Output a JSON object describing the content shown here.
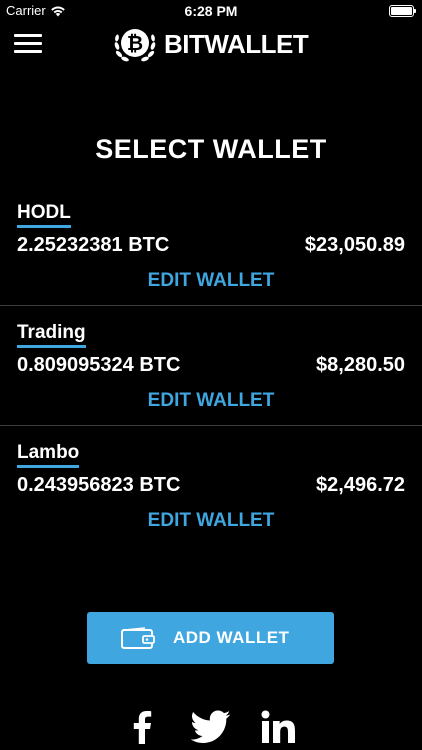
{
  "status_bar": {
    "carrier": "Carrier",
    "time": "6:28 PM"
  },
  "header": {
    "brand_title": "BITWALLET"
  },
  "page_title": "SELECT WALLET",
  "wallets": [
    {
      "name": "HODL",
      "btc": "2.25232381 BTC",
      "usd": "$23,050.89",
      "edit_label": "EDIT WALLET"
    },
    {
      "name": "Trading",
      "btc": "0.809095324 BTC",
      "usd": "$8,280.50",
      "edit_label": "EDIT WALLET"
    },
    {
      "name": "Lambo",
      "btc": "0.243956823 BTC",
      "usd": "$2,496.72",
      "edit_label": "EDIT WALLET"
    }
  ],
  "add_wallet_label": "ADD WALLET",
  "social": [
    "facebook-icon",
    "twitter-icon",
    "linkedin-icon"
  ],
  "colors": {
    "accent": "#3fa6e0",
    "background": "#000000",
    "divider": "#3c3c3c"
  }
}
